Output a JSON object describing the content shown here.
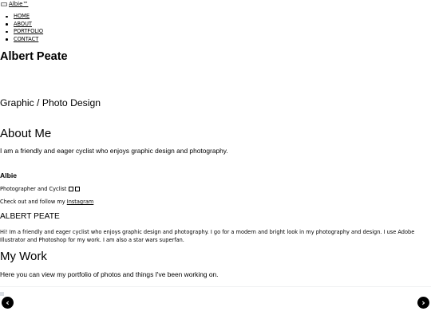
{
  "brand": "Albie™",
  "nav": [
    "HOME",
    "ABOUT",
    "PORTFOLIO",
    "CONTACT"
  ],
  "hero": {
    "name": "Albert Peate",
    "subtitle": "Graphic / Photo Design"
  },
  "about": {
    "heading": "About Me",
    "text": "I am a friendly and eager cyclist who enjoys graphic design and photography."
  },
  "card": {
    "title": "Albie",
    "subtitle": "Photographer and Cyclist",
    "follow_prefix": "Check out and follow my ",
    "follow_link": "Instagram"
  },
  "bio": {
    "name": "ALBERT PEATE",
    "text": "Hi! Im a friendly and eager cyclist who enjoys graphic design and photography. I go for a modern and bright look in my photography and design. I use Adobe Illustrator and Photoshop for my work. I am also a star wars superfan."
  },
  "work": {
    "heading": "My Work",
    "text": "Here you can view my portfolio of photos and things I've been working on."
  },
  "carousel": {
    "prev_icon": "‹",
    "next_icon": "›"
  }
}
